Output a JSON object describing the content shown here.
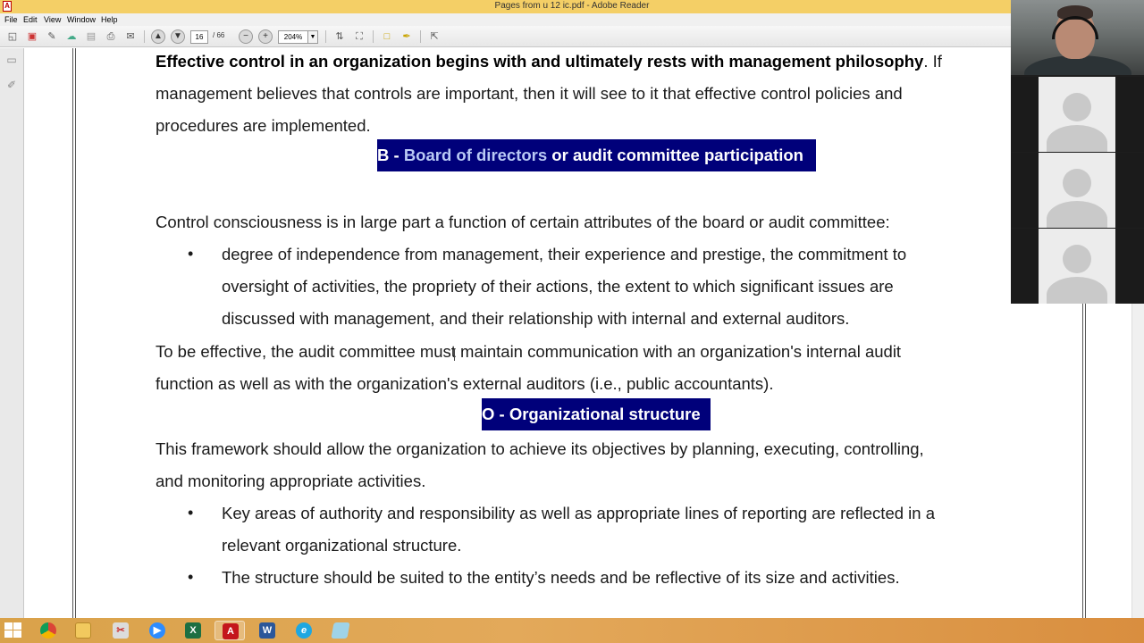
{
  "window": {
    "title": "Pages from u 12  ic.pdf - Adobe Reader"
  },
  "menu": [
    "File",
    "Edit",
    "View",
    "Window",
    "Help"
  ],
  "toolbar": {
    "current_page": "16",
    "total_pages": "/ 66",
    "zoom": "204%",
    "icons": [
      "create-icon",
      "combine-icon",
      "edit-icon",
      "cloud-icon",
      "save-icon",
      "print-icon",
      "email-icon",
      "prev-page-icon",
      "next-page-icon",
      "zoom-out-icon",
      "zoom-in-icon",
      "fit-page-icon",
      "fit-width-icon",
      "comment-icon",
      "sign-icon",
      "expand-icon"
    ]
  },
  "document": {
    "p1_line1_bold": "Effective control in an organization begins with and ultimately rests with management philosophy",
    "p1_line1_rest": ". If",
    "p1_line2": "management believes that controls are important, then it will see to it that effective control policies and",
    "p1_line3": "procedures are implemented.",
    "heading_b_prefix": "B - ",
    "heading_b_highlight": "Board of directors",
    "heading_b_rest": " or audit committee participation",
    "p2_line1": "Control consciousness is in large part a function of certain attributes of the board or audit committee:",
    "bullet1_line1": "degree of independence from management, their experience and prestige,  the commitment to",
    "bullet1_line2": "oversight of activities, the propriety of their actions, the extent to which significant issues are",
    "bullet1_line3": "discussed with management, and their relationship with internal and external auditors.",
    "p3_line1": "To be effective, the audit committee must maintain communication with an organization's internal audit",
    "p3_line2": "function as well as with the organization's external auditors (i.e., public accountants).",
    "heading_o": "O - Organizational structure",
    "p4_line1": "This framework should allow the organization to achieve its objectives by planning, executing, controlling,",
    "p4_line2": "and monitoring appropriate activities.",
    "bullet2_line1": "Key areas of authority and responsibility as well as appropriate lines of reporting are reflected in a",
    "bullet2_line2": "relevant organizational structure.",
    "bullet3_line1": "The structure should be suited to the entity’s needs and be reflective of its size and activities.",
    "bullet_char": "•"
  },
  "call": {
    "participants": [
      "presenter-video",
      "participant-2",
      "participant-3",
      "participant-4"
    ]
  },
  "taskbar": {
    "apps": [
      "chrome",
      "file-explorer",
      "snipping-tool",
      "zoom",
      "excel",
      "adobe-reader",
      "word",
      "internet-explorer",
      "notepad"
    ],
    "labels": {
      "excel": "X",
      "adobe": "A",
      "word": "W",
      "ie": "e"
    }
  },
  "colors": {
    "heading_bg": "#00007a",
    "heading_highlight": "#b9c9f5",
    "titlebar": "#f4cf66",
    "taskbar": "#e3a95a"
  }
}
